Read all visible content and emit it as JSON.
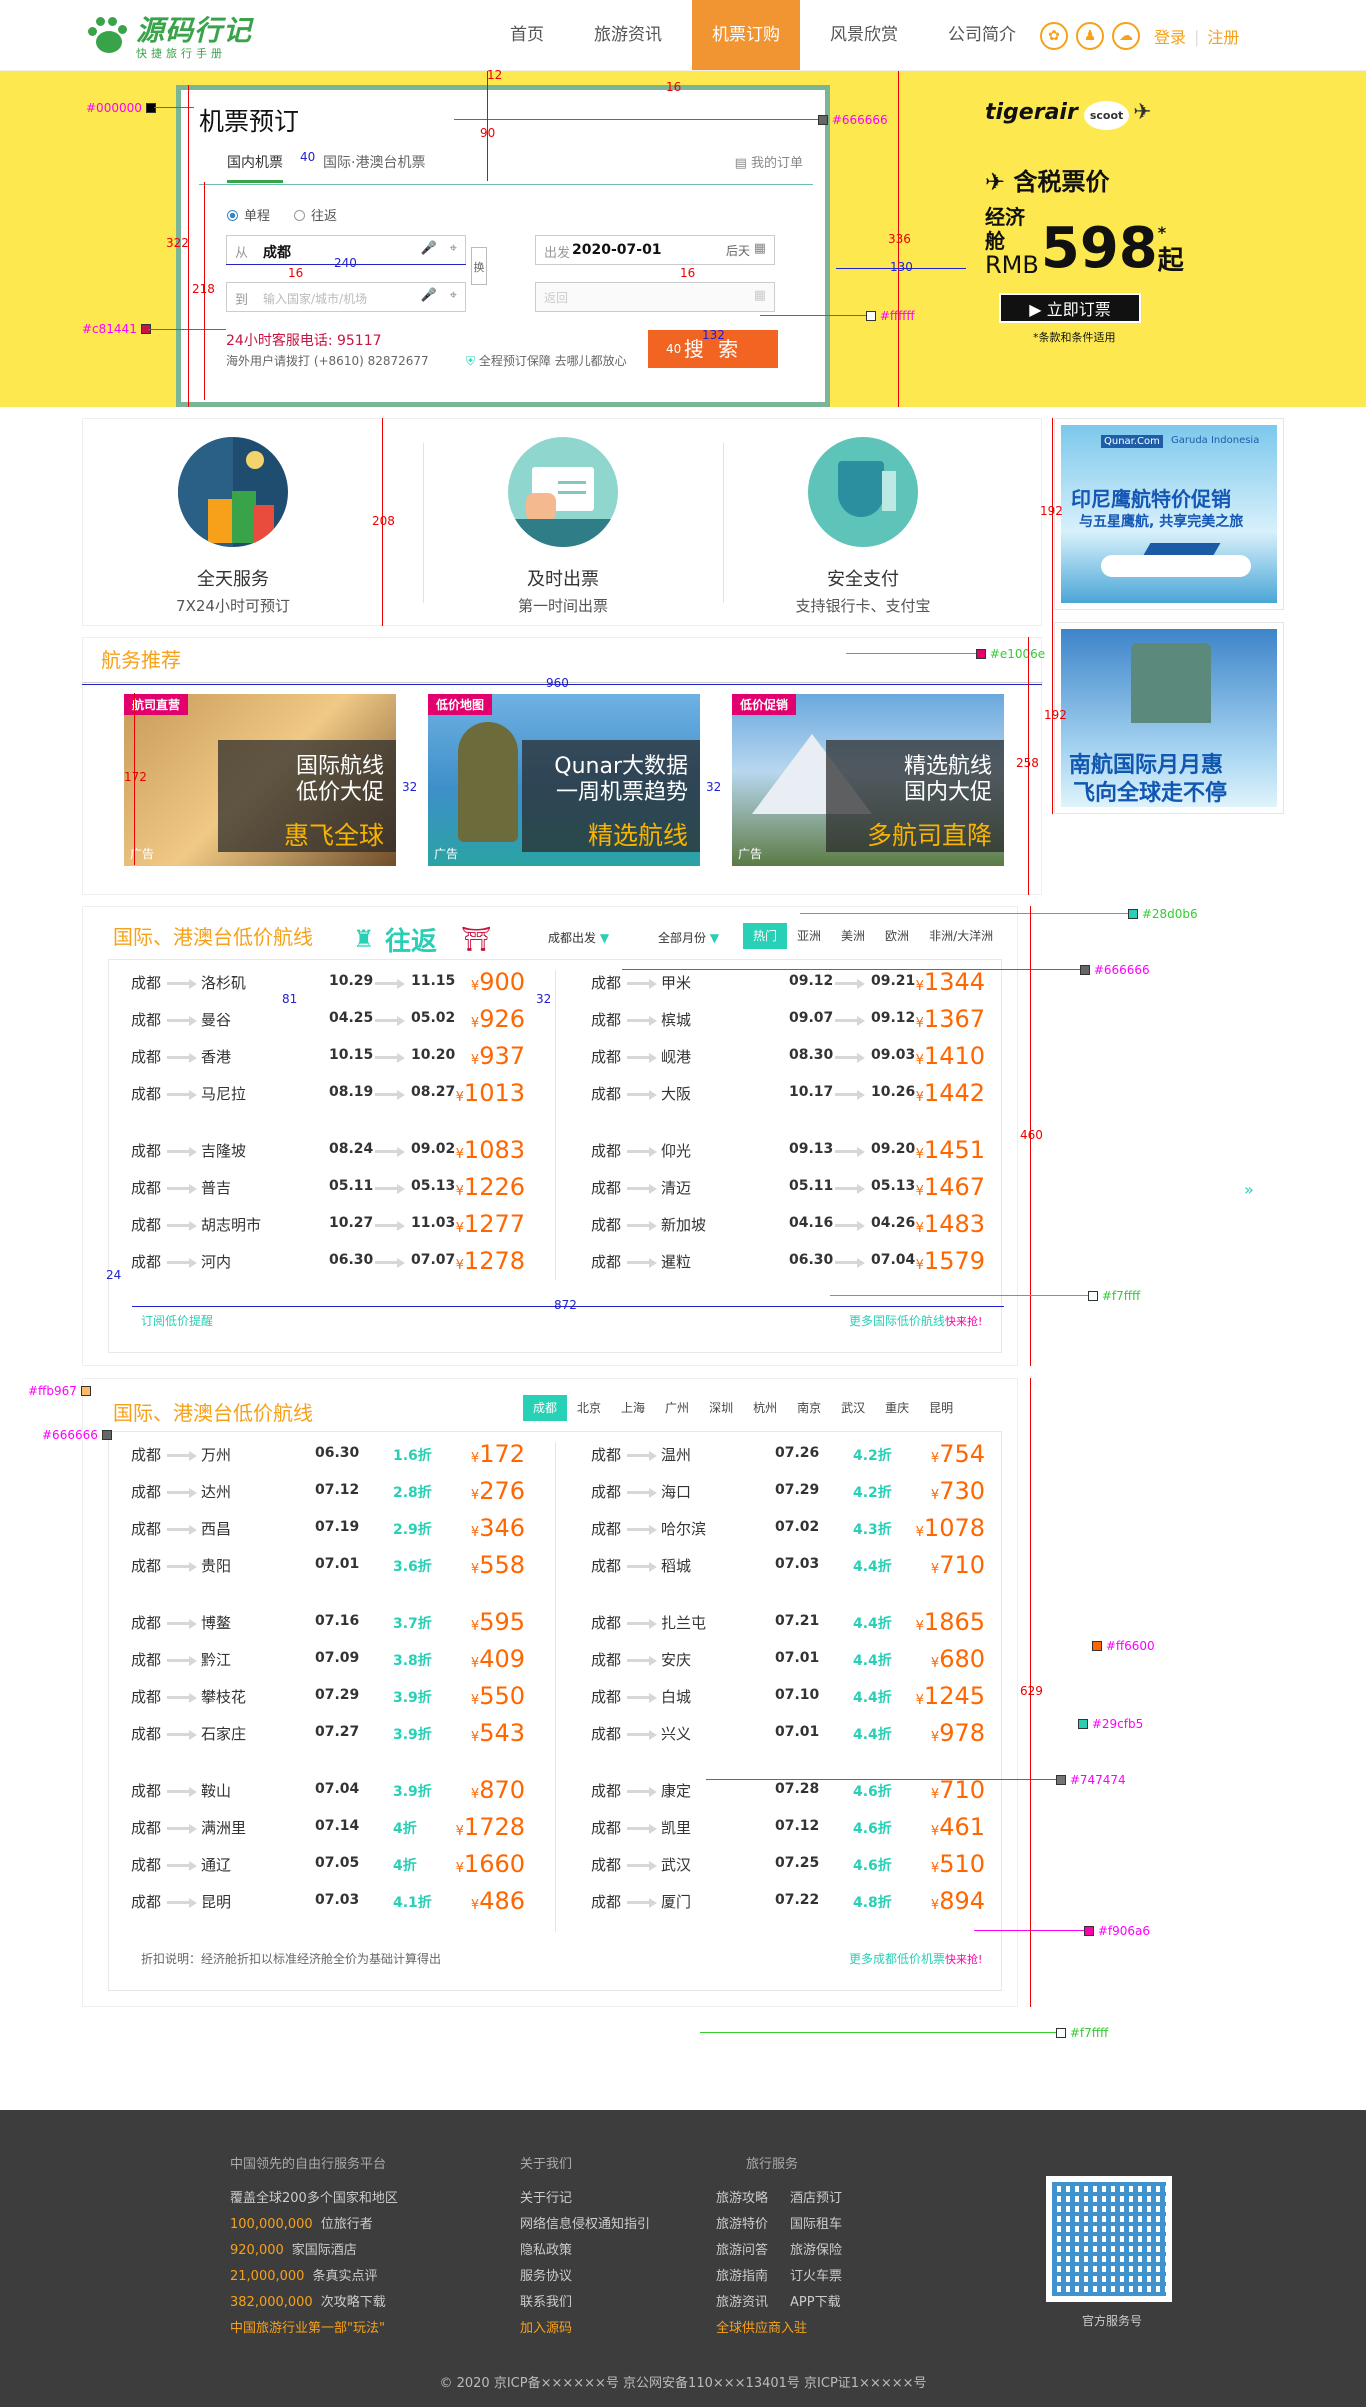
{
  "header": {
    "logo_title": "源码行记",
    "logo_sub": "快捷旅行手册",
    "nav": [
      "首页",
      "旅游资讯",
      "机票订购",
      "风景欣赏",
      "公司简介"
    ],
    "login": "登录",
    "sep": "|",
    "register": "注册"
  },
  "booking": {
    "title": "机票预订",
    "tab_domestic": "国内机票",
    "tab_intl": "国际·港澳台机票",
    "my_order": "我的订单",
    "oneway": "单程",
    "roundtrip": "往返",
    "from_label": "从",
    "from_value": "成都",
    "to_label": "到",
    "to_placeholder": "输入国家/城市/机场",
    "depart_label": "出发",
    "depart_value": "2020-07-01",
    "depart_after": "后天",
    "return_placeholder": "返回",
    "swap": "换",
    "hotline": "24小时客服电话: 95117",
    "overseas": "海外用户请拨打 (+8610) 82872677",
    "guarantee": "全程预订保障 去哪儿都放心",
    "search": "搜 索"
  },
  "promo": {
    "airline": "tigerair",
    "partner": "scoot",
    "heading": "含税票价",
    "cabin": "经济舱",
    "currency": "RMB",
    "price": "598",
    "star": "*",
    "unit": "起",
    "button": "立即订票",
    "fine": "*条款和条件适用"
  },
  "features": [
    {
      "title": "全天服务",
      "sub": "7X24小时可预订"
    },
    {
      "title": "及时出票",
      "sub": "第一时间出票"
    },
    {
      "title": "安全支付",
      "sub": "支持银行卡、支付宝"
    }
  ],
  "side_ads": [
    {
      "line1": "印尼鹰航特价促销",
      "line2": "与五星鹰航, 共享完美之旅",
      "brand1": "Qunar.Com",
      "brand2": "Garuda Indonesia"
    },
    {
      "line1": "南航国际月月惠",
      "line2": "飞向全球走不停"
    }
  ],
  "recommend": {
    "title": "航务推荐",
    "cards": [
      {
        "tag": "航司直营",
        "l1": "国际航线",
        "l2": "低价大促",
        "l3": "惠飞全球",
        "ad": "广告"
      },
      {
        "tag": "低价地图",
        "l1": "Qunar大数据",
        "l2": "一周机票趋势",
        "l3": "精选航线",
        "ad": "广告"
      },
      {
        "tag": "低价促销",
        "l1": "精选航线",
        "l2": "国内大促",
        "l3": "多航司直降",
        "ad": "广告"
      }
    ]
  },
  "intl": {
    "title": "国际、港澳台低价航线",
    "roundtrip_badge": "往返",
    "depart_filter": "成都出发",
    "month_filter": "全部月份",
    "regions": [
      "热门",
      "亚洲",
      "美洲",
      "欧洲",
      "非洲/大洋洲"
    ],
    "left": [
      {
        "from": "成都",
        "to": "洛杉矶",
        "d1": "10.29",
        "d2": "11.15",
        "price": "900"
      },
      {
        "from": "成都",
        "to": "曼谷",
        "d1": "04.25",
        "d2": "05.02",
        "price": "926"
      },
      {
        "from": "成都",
        "to": "香港",
        "d1": "10.15",
        "d2": "10.20",
        "price": "937"
      },
      {
        "from": "成都",
        "to": "马尼拉",
        "d1": "08.19",
        "d2": "08.27",
        "price": "1013"
      },
      {
        "from": "成都",
        "to": "吉隆坡",
        "d1": "08.24",
        "d2": "09.02",
        "price": "1083"
      },
      {
        "from": "成都",
        "to": "普吉",
        "d1": "05.11",
        "d2": "05.13",
        "price": "1226"
      },
      {
        "from": "成都",
        "to": "胡志明市",
        "d1": "10.27",
        "d2": "11.03",
        "price": "1277"
      },
      {
        "from": "成都",
        "to": "河内",
        "d1": "06.30",
        "d2": "07.07",
        "price": "1278"
      }
    ],
    "right": [
      {
        "from": "成都",
        "to": "甲米",
        "d1": "09.12",
        "d2": "09.21",
        "price": "1344"
      },
      {
        "from": "成都",
        "to": "槟城",
        "d1": "09.07",
        "d2": "09.12",
        "price": "1367"
      },
      {
        "from": "成都",
        "to": "岘港",
        "d1": "08.30",
        "d2": "09.03",
        "price": "1410"
      },
      {
        "from": "成都",
        "to": "大阪",
        "d1": "10.17",
        "d2": "10.26",
        "price": "1442"
      },
      {
        "from": "成都",
        "to": "仰光",
        "d1": "09.13",
        "d2": "09.20",
        "price": "1451"
      },
      {
        "from": "成都",
        "to": "清迈",
        "d1": "05.11",
        "d2": "05.13",
        "price": "1467"
      },
      {
        "from": "成都",
        "to": "新加坡",
        "d1": "04.16",
        "d2": "04.26",
        "price": "1483"
      },
      {
        "from": "成都",
        "to": "暹粒",
        "d1": "06.30",
        "d2": "07.04",
        "price": "1579"
      }
    ],
    "subscribe": "订阅低价提醒",
    "more": "更多国际低价航线",
    "hot": "快来抢!"
  },
  "domestic": {
    "title": "国际、港澳台低价航线",
    "cities": [
      "成都",
      "北京",
      "上海",
      "广州",
      "深圳",
      "杭州",
      "南京",
      "武汉",
      "重庆",
      "昆明"
    ],
    "left": [
      {
        "from": "成都",
        "to": "万州",
        "d": "06.30",
        "disc": "1.6折",
        "price": "172"
      },
      {
        "from": "成都",
        "to": "达州",
        "d": "07.12",
        "disc": "2.8折",
        "price": "276"
      },
      {
        "from": "成都",
        "to": "西昌",
        "d": "07.19",
        "disc": "2.9折",
        "price": "346"
      },
      {
        "from": "成都",
        "to": "贵阳",
        "d": "07.01",
        "disc": "3.6折",
        "price": "558"
      },
      {
        "from": "成都",
        "to": "博鳌",
        "d": "07.16",
        "disc": "3.7折",
        "price": "595"
      },
      {
        "from": "成都",
        "to": "黔江",
        "d": "07.09",
        "disc": "3.8折",
        "price": "409"
      },
      {
        "from": "成都",
        "to": "攀枝花",
        "d": "07.29",
        "disc": "3.9折",
        "price": "550"
      },
      {
        "from": "成都",
        "to": "石家庄",
        "d": "07.27",
        "disc": "3.9折",
        "price": "543"
      },
      {
        "from": "成都",
        "to": "鞍山",
        "d": "07.04",
        "disc": "3.9折",
        "price": "870"
      },
      {
        "from": "成都",
        "to": "满洲里",
        "d": "07.14",
        "disc": "4折",
        "price": "1728"
      },
      {
        "from": "成都",
        "to": "通辽",
        "d": "07.05",
        "disc": "4折",
        "price": "1660"
      },
      {
        "from": "成都",
        "to": "昆明",
        "d": "07.03",
        "disc": "4.1折",
        "price": "486"
      }
    ],
    "right": [
      {
        "from": "成都",
        "to": "温州",
        "d": "07.26",
        "disc": "4.2折",
        "price": "754"
      },
      {
        "from": "成都",
        "to": "海口",
        "d": "07.29",
        "disc": "4.2折",
        "price": "730"
      },
      {
        "from": "成都",
        "to": "哈尔滨",
        "d": "07.02",
        "disc": "4.3折",
        "price": "1078"
      },
      {
        "from": "成都",
        "to": "稻城",
        "d": "07.03",
        "disc": "4.4折",
        "price": "710"
      },
      {
        "from": "成都",
        "to": "扎兰屯",
        "d": "07.21",
        "disc": "4.4折",
        "price": "1865"
      },
      {
        "from": "成都",
        "to": "安庆",
        "d": "07.01",
        "disc": "4.4折",
        "price": "680"
      },
      {
        "from": "成都",
        "to": "白城",
        "d": "07.10",
        "disc": "4.4折",
        "price": "1245"
      },
      {
        "from": "成都",
        "to": "兴义",
        "d": "07.01",
        "disc": "4.4折",
        "price": "978"
      },
      {
        "from": "成都",
        "to": "康定",
        "d": "07.28",
        "disc": "4.6折",
        "price": "710"
      },
      {
        "from": "成都",
        "to": "凯里",
        "d": "07.12",
        "disc": "4.6折",
        "price": "461"
      },
      {
        "from": "成都",
        "to": "武汉",
        "d": "07.25",
        "disc": "4.6折",
        "price": "510"
      },
      {
        "from": "成都",
        "to": "厦门",
        "d": "07.22",
        "disc": "4.8折",
        "price": "894"
      }
    ],
    "note": "折扣说明：经济舱折扣以标准经济舱全价为基础计算得出",
    "more": "更多成都低价机票",
    "hot": "快来抢!"
  },
  "footer": {
    "col1_h": "中国领先的自由行服务平台",
    "col1_intro": "覆盖全球200多个国家和地区",
    "stats": [
      {
        "num": "100,000,000",
        "label": "位旅行者"
      },
      {
        "num": "920,000",
        "label": "家国际酒店"
      },
      {
        "num": "21,000,000",
        "label": "条真实点评"
      },
      {
        "num": "382,000,000",
        "label": "次攻略下载"
      }
    ],
    "col1_slogan": "中国旅游行业第一部\"玩法\"",
    "col2_h": "关于我们",
    "col2": [
      "关于行记",
      "网络信息侵权通知指引",
      "隐私政策",
      "服务协议",
      "联系我们"
    ],
    "col2_join": "加入源码",
    "col3_h": "旅行服务",
    "col3a": [
      "旅游攻略",
      "旅游特价",
      "旅游问答",
      "旅游指南",
      "旅游资讯"
    ],
    "col3b": [
      "酒店预订",
      "国际租车",
      "旅游保险",
      "订火车票",
      "APP下载"
    ],
    "col3_join": "全球供应商入驻",
    "qr_label": "官方服务号",
    "copyright": "© 2020 京ICP备××××××号 京公网安备110×××13401号 京ICP证1×××××号"
  },
  "annotations": {
    "c_000000": "#000000",
    "c_666666": "#666666",
    "c_c81441": "#c81441",
    "c_ffffff": "#ffffff",
    "c_e1006e": "#e1006e",
    "c_28d0b6": "#28d0b6",
    "c_666666b": "#666666",
    "c_f7ffff": "#f7ffff",
    "c_ffb967": "#ffb967",
    "c_666666c": "#666666",
    "c_ff6600": "#ff6600",
    "c_29cfb5": "#29cfb5",
    "c_747474": "#747474",
    "c_f906a6": "#f906a6",
    "c_f7ffff2": "#f7ffff",
    "d12": "12",
    "d16a": "16",
    "d90": "90",
    "d40": "40",
    "d322": "322",
    "d218": "218",
    "d240": "240",
    "d16b": "16",
    "d16c": "16",
    "d336": "336",
    "d130": "130",
    "d40b": "40",
    "d132": "132",
    "d208": "208",
    "d192a": "192",
    "d192b": "192",
    "d960": "960",
    "d258": "258",
    "d172": "172",
    "d32a": "32",
    "d32b": "32",
    "d81": "81",
    "d32c": "32",
    "d460": "460",
    "d24": "24",
    "d872": "872",
    "d629": "629",
    "arrows": "»"
  },
  "colors": {
    "brand": "#39a34a",
    "accent": "#f19432",
    "yellow": "#fde94f",
    "orange": "#ff6600",
    "teal": "#29cfb5",
    "pink": "#e1006e"
  }
}
